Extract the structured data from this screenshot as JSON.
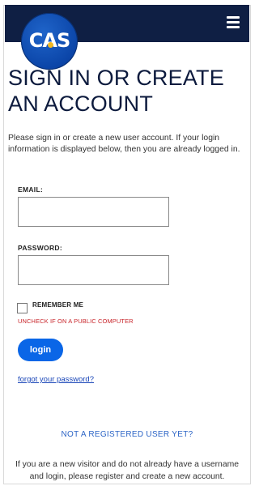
{
  "header": {
    "logo_text": "CAS",
    "menu_icon": "hamburger-menu-icon"
  },
  "page": {
    "title": "SIGN IN OR CREATE AN ACCOUNT",
    "intro": "Please sign in or create a new user account. If your login information is displayed below, then you are already logged in."
  },
  "form": {
    "email_label": "EMAIL:",
    "email_placeholder": "",
    "password_label": "PASSWORD:",
    "password_placeholder": "",
    "remember_label": "REMEMBER ME",
    "remember_checked": false,
    "warning": "UNCHECK IF ON A PUBLIC COMPUTER",
    "login_button": "login",
    "forgot_link": "forgot your password?"
  },
  "register": {
    "heading": "NOT A REGISTERED USER YET?",
    "text": "If you are a new visitor and do not already have a username and login, please register and create a new account."
  },
  "colors": {
    "topbar": "#0f1f44",
    "accent_blue": "#0a66e7",
    "warning_red": "#c8252b",
    "logo_gold": "#f1b821"
  }
}
